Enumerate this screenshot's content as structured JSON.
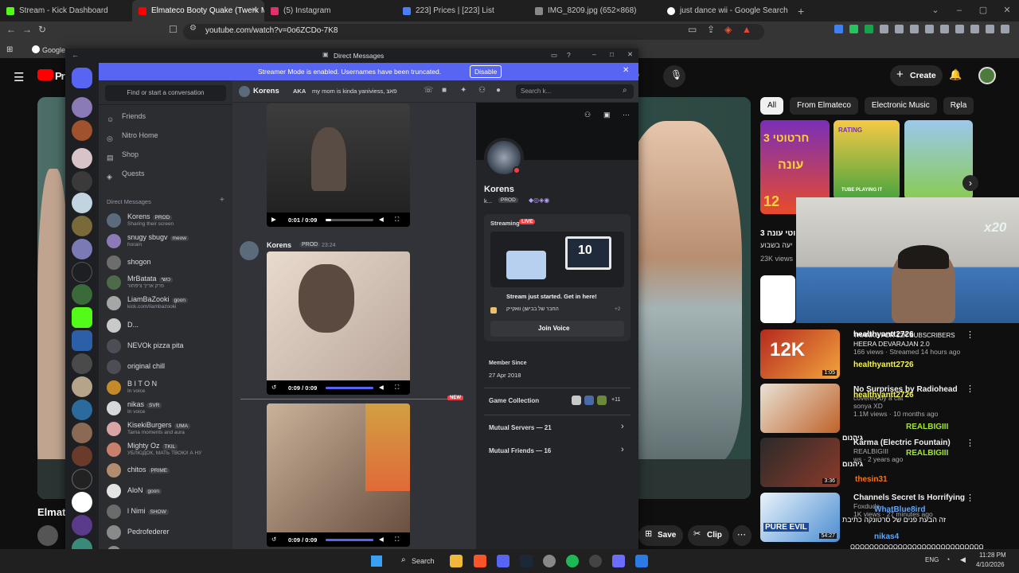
{
  "browser": {
    "tabs": [
      {
        "label": "Stream - Kick Dashboard",
        "color": "#53fc18"
      },
      {
        "label": "Elmateco Booty Quake (Twerk M",
        "color": "#ff0000"
      },
      {
        "label": "(5) Instagram",
        "color": "#e1306c"
      },
      {
        "label": "223] Prices | [223] List",
        "color": "#4a7dff"
      },
      {
        "label": "IMG_8209.jpg (652×868)",
        "color": "#888888"
      },
      {
        "label": "just dance wii - Google Search",
        "color": "#4285f4"
      }
    ],
    "url": "youtube.com/watch?v=0o6ZCDo-7K8",
    "bookmark_google": "Google"
  },
  "youtube": {
    "logo_partial": "Pr",
    "create_label": "Create",
    "chips": [
      "All",
      "From Elmateco",
      "Electronic Music",
      "Rela"
    ],
    "channel_partial": "Elmat",
    "save_label": "Save",
    "clip_label": "Clip",
    "thumbnail_texts": [
      "חרטוטי 3",
      "עונה",
      "12",
      "RATING",
      "TUBE PLAYING IT"
    ],
    "rec_partial": {
      "title": "3 טוטי עונה",
      "sub": "יעה בשבוע",
      "views": "23K views"
    },
    "recommendations": [
      {
        "title": "THANKS FOR 12K SUBSCRIBERS",
        "thumb_text": "12K",
        "channel": "HEERA DEVARAJAN 2.0",
        "meta": "166 views · Streamed 14 hours ago",
        "duration": "1:05"
      },
      {
        "title": "No Surprises by Radiohead",
        "channel": "covered by a cat",
        "meta": "1.1M views · 10 months ago",
        "author": "sonya XD",
        "duration": ""
      },
      {
        "title": "Karma (Electric Fountain)",
        "channel": "REALBIGIII",
        "meta": "ws · 2 years ago",
        "duration": "3:36"
      },
      {
        "title": "Channels Secret Is Horrifying",
        "thumb_text": "PURE EVIL",
        "channel": "Foxdude",
        "meta": "1K views · 27 minutes ago",
        "duration": "54:27"
      }
    ]
  },
  "chat_overlay": [
    {
      "name": "healthyantt2726",
      "text": ""
    },
    {
      "name": "healthyantt2726",
      "text": ""
    },
    {
      "name": "healthyantt2726",
      "text": ""
    },
    {
      "name": "REALBIGIII",
      "text": ""
    },
    {
      "name": "REALBIGIII",
      "text": ""
    },
    {
      "name": "thesin31",
      "text": ""
    },
    {
      "name": "WhatBlue8ird",
      "text": "זה הבעת פנים של סרטונקה כתיבת"
    },
    {
      "name": "nikas4",
      "text": "ΩΩΩΩΩΩΩΩΩΩΩΩΩΩΩΩΩΩΩΩΩΩΩΩΩΩΩΩ"
    },
    {
      "name": "",
      "text": "ΩΩΩΩΩΩΩΩΩΩΩ"
    },
    {
      "name": "",
      "text": "גיהנום"
    },
    {
      "name": "",
      "text": "גיהנום"
    }
  ],
  "webcam": {
    "badge": "x20"
  },
  "discord": {
    "title": "Direct Messages",
    "banner_text": "Streamer Mode is enabled. Usernames have been truncated.",
    "banner_button": "Disable",
    "search_placeholder": "Find or start a conversation",
    "nav": [
      "Friends",
      "Nitro Home",
      "Shop",
      "Quests"
    ],
    "dm_header": "Direct Messages",
    "dms": [
      {
        "name": "Korens",
        "tag": "PROD",
        "sub": "Sharing their screen",
        "color": "#5b6b7c"
      },
      {
        "name": "snugy sbugv",
        "tag": "meow",
        "sub": "horain",
        "color": "#8a7ab5"
      },
      {
        "name": "shogon",
        "tag": "",
        "sub": "",
        "color": "#6d6d6d"
      },
      {
        "name": "MrBatata",
        "tag": "כושי",
        "sub": "פרק אריך ציפחור",
        "color": "#4d6b4a"
      },
      {
        "name": "LiamBaZooki",
        "tag": "goon",
        "sub": "kick.com/liambazooki",
        "color": "#a6a6a6"
      },
      {
        "name": "D...",
        "tag": "",
        "sub": "",
        "color": "#c9c9c9"
      },
      {
        "name": "NEVOk pizza pita",
        "tag": "",
        "sub": "",
        "color": "#4b4e55"
      },
      {
        "name": "original chill",
        "tag": "",
        "sub": "",
        "color": "#4b4e55"
      },
      {
        "name": "B I T O N",
        "tag": "",
        "sub": "In voice",
        "color": "#c48a2a"
      },
      {
        "name": "nikas",
        "tag": "SVR",
        "sub": "In voice",
        "color": "#d8d8d8"
      },
      {
        "name": "KisekiBurgers",
        "tag": "UMA",
        "sub": "Tama moments and aura",
        "color": "#d9a4a4"
      },
      {
        "name": "Mighty Oz",
        "tag": "TKIL",
        "sub": "УБЛЮДОК, МАТЬ ТВОЮ! А НУ",
        "color": "#c87f6c"
      },
      {
        "name": "chitos",
        "tag": "PRIME",
        "sub": "",
        "color": "#b08d6c"
      },
      {
        "name": "AloN",
        "tag": "goon",
        "sub": "",
        "color": "#e3e3e3"
      },
      {
        "name": "l Nimi",
        "tag": "SHOW",
        "sub": "",
        "color": "#6b6b6b"
      },
      {
        "name": "Pedrofederer",
        "tag": "",
        "sub": "",
        "color": "#8a8a8a"
      },
      {
        "name": "d...",
        "tag": "",
        "sub": "",
        "color": "#8a8a8a"
      }
    ],
    "chat": {
      "header_name": "Korens",
      "header_aka": "AKA",
      "header_aka_value": "my mom is kinda yaniviess, פאצ",
      "search": "Search k...",
      "author": "Korens",
      "author_tag": "PROD",
      "time": "23:24",
      "new_badge": "NEW",
      "videos": [
        {
          "time": "0:01 / 0:09",
          "progress": 0.11
        },
        {
          "time": "0:09 / 0:09",
          "progress": 1.0
        },
        {
          "time": "0:09 / 0:09",
          "progress": 1.0
        }
      ]
    },
    "profile": {
      "name": "Korens",
      "sub": "k...",
      "tag": "PROD",
      "streaming_label": "Streaming",
      "live_badge": "LIVE",
      "stream_text": "Stream just started. Get in here!",
      "activity": "החבר של בבישן) וואקייק",
      "activity_more": "+2",
      "join_button": "Join Voice",
      "member_since_label": "Member Since",
      "member_since": "27 Apr 2018",
      "game_collection": "Game Collection",
      "game_more": "+11",
      "mutual_servers": "Mutual Servers — 21",
      "mutual_friends": "Mutual Friends — 16",
      "tv_number": "10"
    }
  },
  "taskbar": {
    "search": "Search",
    "lang": "ENG",
    "time": "11:28 PM",
    "date": "4/10/2026"
  }
}
